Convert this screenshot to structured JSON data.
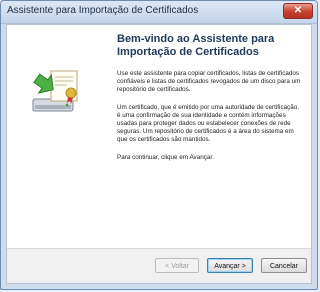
{
  "window": {
    "title": "Assistente para Importação de Certificados",
    "close_glyph": "✕"
  },
  "wizard": {
    "icon": "certificate-import-icon",
    "heading": "Bem-vindo ao Assistente para Importação de Certificados",
    "paragraphs": [
      "Use este assistente para copiar certificados, listas de certificados confiáveis e listas de certificados revogados de um disco para um repositório de certificados.",
      "Um certificado, que é emitido por uma autoridade de certificação, é uma confirmação de sua identidade e contém informações usadas para proteger dados ou estabelecer conexões de rede seguras. Um repositório de certificados é a área do sistema em que os certificados são mantidos.",
      "Para continuar, clique em Avançar."
    ]
  },
  "buttons": {
    "back": "< Voltar",
    "next": "Avançar >",
    "cancel": "Cancelar"
  },
  "colors": {
    "accent": "#1e395b",
    "close": "#c9402e"
  }
}
